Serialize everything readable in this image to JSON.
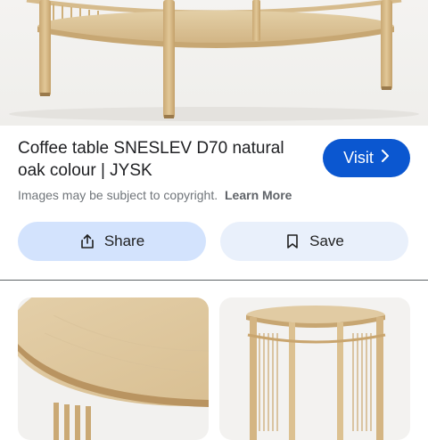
{
  "product": {
    "title": "Coffee table SNESLEV D70 natural oak colour | JYSK"
  },
  "visit": {
    "label": "Visit",
    "icon": "chevron-right-icon"
  },
  "notice": {
    "text": "Images may be subject to copyright.",
    "link": "Learn More"
  },
  "actions": {
    "share_label": "Share",
    "share_icon": "share-icon",
    "save_label": "Save",
    "save_icon": "bookmark-icon"
  },
  "colors": {
    "primary": "#0b57d0",
    "share_bg": "#d3e3fd",
    "save_bg": "#e9f0fb",
    "wood": "#d8bf93"
  }
}
